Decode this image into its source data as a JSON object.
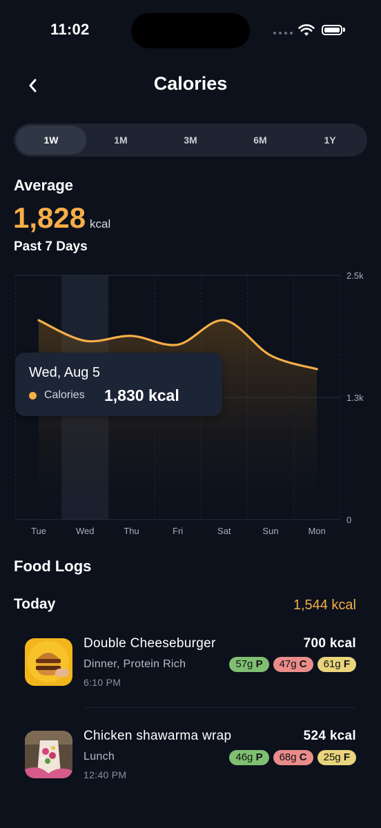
{
  "status_bar": {
    "time": "11:02"
  },
  "header": {
    "title": "Calories"
  },
  "segments": [
    "1W",
    "1M",
    "3M",
    "6M",
    "1Y"
  ],
  "selected_segment": "1W",
  "summary": {
    "label": "Average",
    "value": "1,828",
    "unit": "kcal",
    "period": "Past 7 Days"
  },
  "colors": {
    "accent": "#f6ae48",
    "background": "#0c111c",
    "protein": "#7fbf72",
    "carbs": "#e98c8a",
    "fat": "#e9d47c"
  },
  "chart_data": {
    "type": "area",
    "x": [
      "Tue",
      "Wed",
      "Thu",
      "Fri",
      "Sat",
      "Sun",
      "Mon"
    ],
    "series": [
      {
        "name": "Calories",
        "values": [
          2040,
          1830,
          1880,
          1790,
          2040,
          1680,
          1540
        ]
      }
    ],
    "ylim": [
      0,
      2500
    ],
    "y_tick_labels": [
      "2.5k",
      "1.3k",
      "0"
    ],
    "highlighted_category": "Wed",
    "grid": true
  },
  "tooltip": {
    "date": "Wed, Aug 5",
    "series": "Calories",
    "value": "1,830 kcal"
  },
  "food_logs": {
    "title": "Food Logs",
    "day": "Today",
    "day_total": "1,544 kcal",
    "entries": [
      {
        "name": "Double Cheeseburger",
        "meta": "Dinner, Protein Rich",
        "time": "6:10 PM",
        "kcal": "700 kcal",
        "protein": "57g",
        "carbs": "47g",
        "fat": "61g",
        "p": "P",
        "c": "C",
        "f": "F"
      },
      {
        "name": "Chicken shawarma wrap",
        "meta": "Lunch",
        "time": "12:40 PM",
        "kcal": "524 kcal",
        "protein": "46g",
        "carbs": "68g",
        "fat": "25g",
        "p": "P",
        "c": "C",
        "f": "F"
      }
    ]
  }
}
